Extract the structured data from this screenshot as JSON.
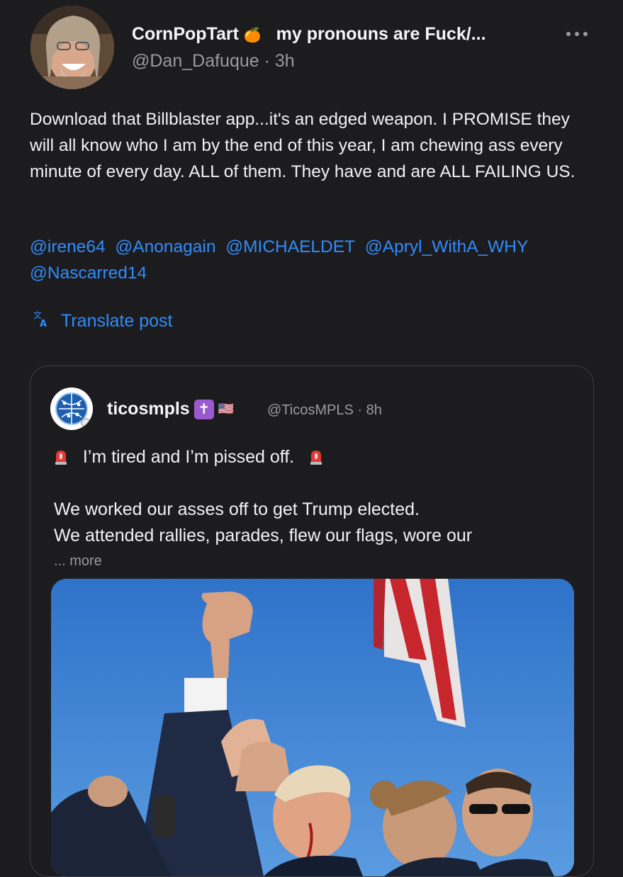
{
  "post": {
    "author": {
      "display_name": "CornPopTart",
      "emoji": "🍊",
      "pronouns_text": "my pronouns are Fuck/...",
      "handle": "@Dan_Dafuque",
      "time": "· 3h"
    },
    "text": "Download that Billblaster app...it's an edged weapon. I PROMISE they will all know who I am by the end of this year, I am chewing ass every minute of every day. ALL of them. They have and are ALL FAILING US.",
    "mentions": [
      "@irene64",
      "@Anonagain",
      "@MICHAELDET",
      "@Apryl_WithA_WHY",
      "@Nascarred14"
    ],
    "translate_label": "Translate post"
  },
  "quote": {
    "author": {
      "display_name": "ticosmpls",
      "badge": "✝",
      "flag": "🇺🇸",
      "handle": "@TicosMPLS",
      "time": "· 8h"
    },
    "line1": "I’m tired and I’m pissed off.",
    "line2": "We worked our asses off to get Trump elected.",
    "line3": "We attended rallies, parades, flew our flags, wore our",
    "more_label": "... more"
  },
  "colors": {
    "background": "#1c1c1e",
    "link": "#2f8cff",
    "muted": "#9a9aa0",
    "card_border": "#3e3e42"
  },
  "icons": [
    "more-options-icon",
    "translate-icon",
    "siren-icon",
    "verified-badge-icon"
  ]
}
